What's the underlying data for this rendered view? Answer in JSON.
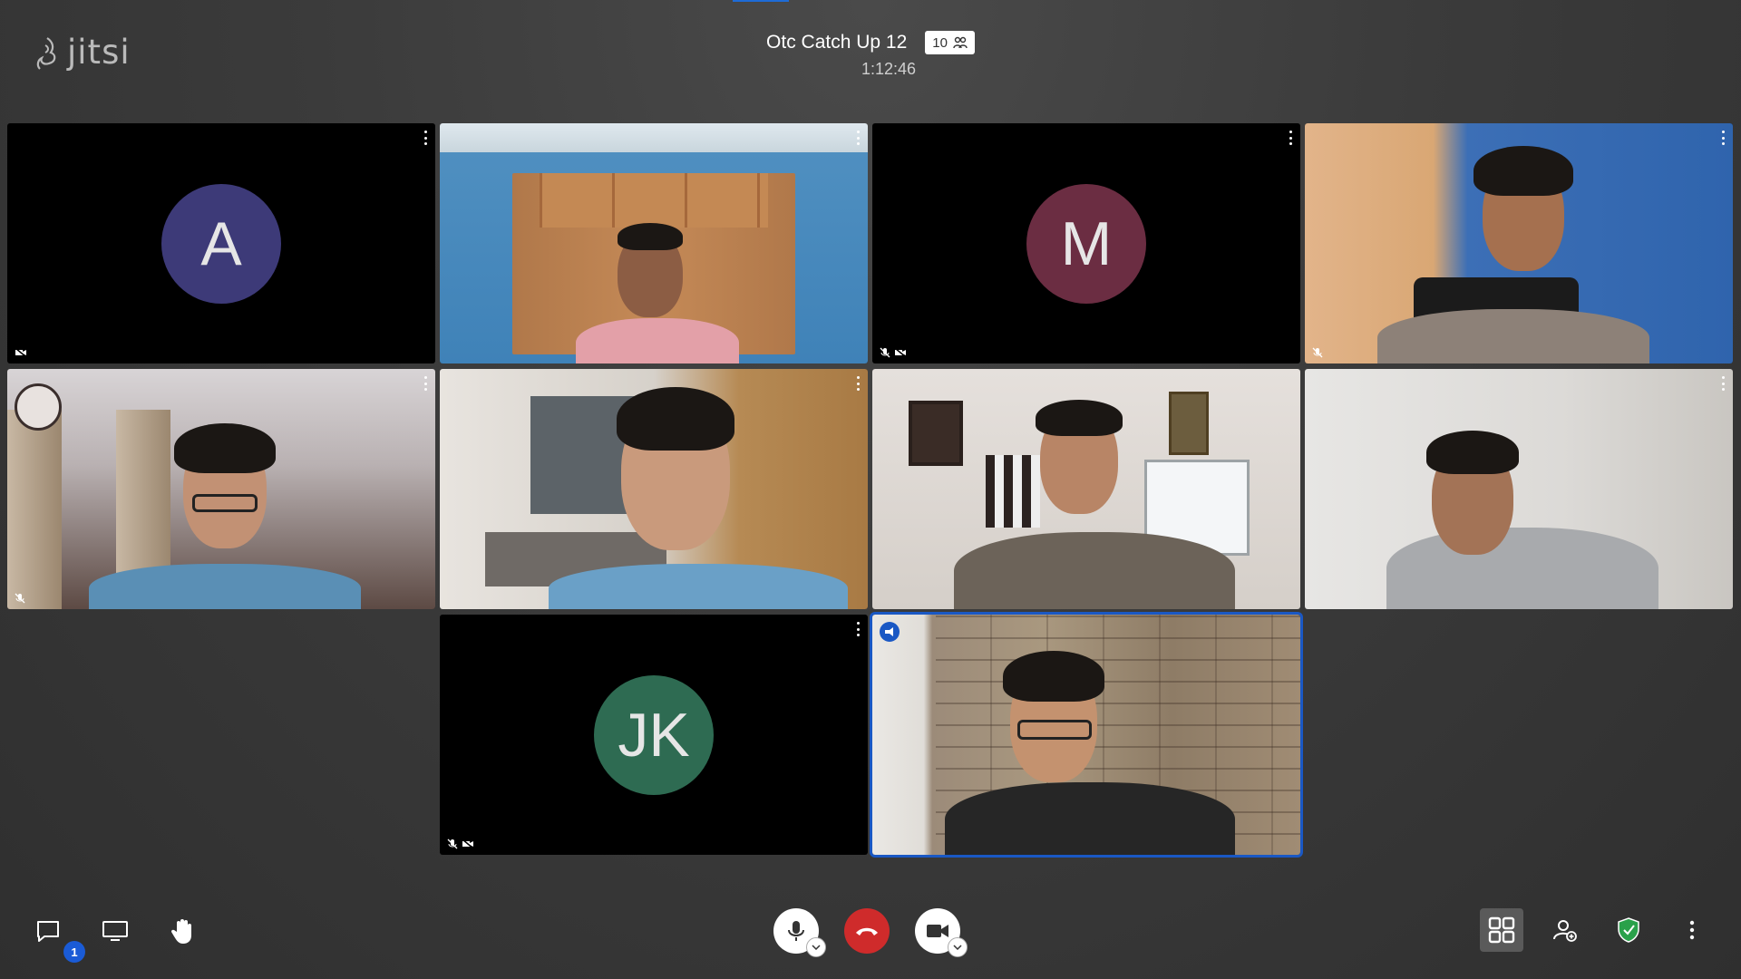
{
  "app": {
    "logo_text": "jitsi"
  },
  "meeting": {
    "title": "Otc Catch Up 12",
    "participant_count": "10",
    "elapsed": "1:12:46"
  },
  "tiles": [
    {
      "type": "avatar",
      "initials": "A",
      "avatar_color": "#3d3a78",
      "status": [
        "camera-off"
      ]
    },
    {
      "type": "video",
      "scene": "room with wooden cupboards, person with headphones",
      "status": []
    },
    {
      "type": "avatar",
      "initials": "M",
      "avatar_color": "#6b2d42",
      "status": [
        "mic-off",
        "camera-off"
      ]
    },
    {
      "type": "video",
      "scene": "person in front of blue wall",
      "status": [
        "mic-off"
      ]
    },
    {
      "type": "video",
      "scene": "person with glasses, curtains and clock",
      "status": [
        "mic-off"
      ]
    },
    {
      "type": "video",
      "scene": "person smiling in kitchen",
      "status": []
    },
    {
      "type": "video",
      "scene": "person with headphones near whiteboard",
      "status": []
    },
    {
      "type": "video",
      "scene": "person resting chin on hand, white wall",
      "status": []
    },
    {
      "type": "avatar",
      "initials": "JK",
      "avatar_color": "#2e6b52",
      "status": [
        "mic-off",
        "camera-off"
      ]
    },
    {
      "type": "video",
      "scene": "person with glasses, stone wall",
      "status": [],
      "dominant_speaker": true
    }
  ],
  "toolbar": {
    "chat_unread": "1",
    "left": [
      "chat-icon",
      "screenshare-icon",
      "raise-hand-icon"
    ],
    "center": [
      "microphone-icon",
      "hangup-icon",
      "camera-icon"
    ],
    "right": [
      "tile-view-icon",
      "invite-icon",
      "security-shield-icon",
      "more-icon"
    ]
  },
  "colors": {
    "hangup": "#cf2b2b",
    "accent": "#1a58c4",
    "shield": "#2aa14a"
  }
}
